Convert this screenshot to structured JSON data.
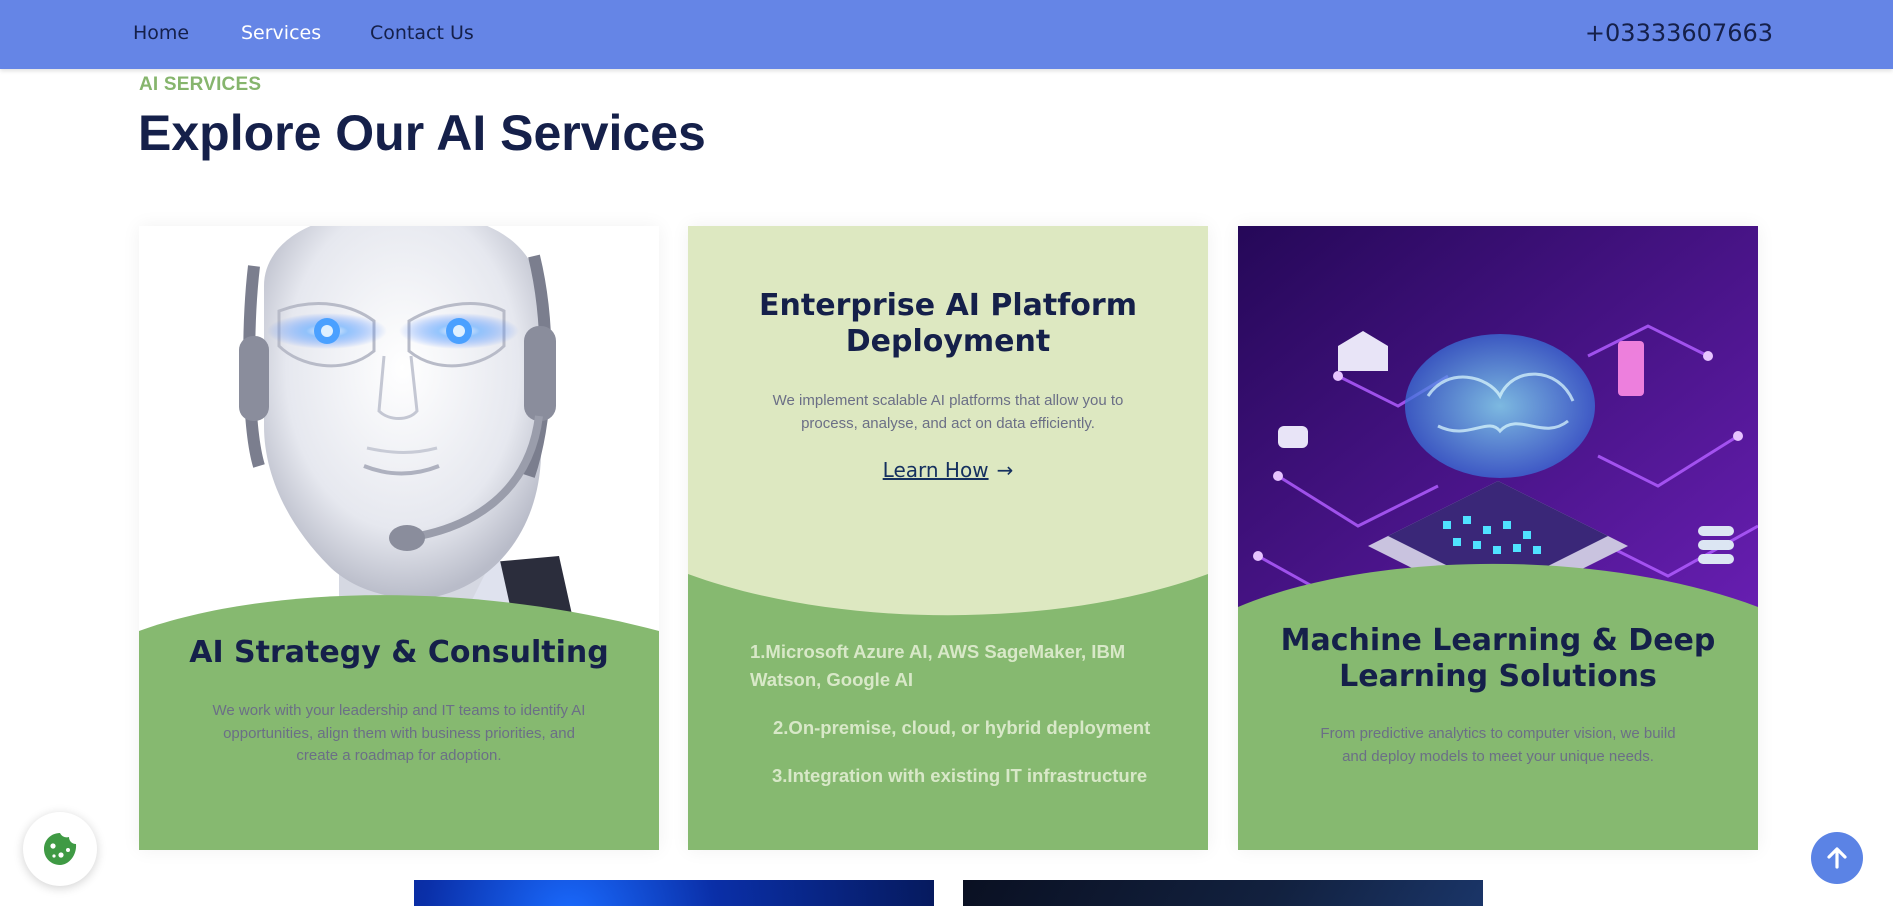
{
  "nav": {
    "items": [
      {
        "label": "Home"
      },
      {
        "label": "Services"
      },
      {
        "label": "Contact Us"
      }
    ],
    "phone": "+03333607663"
  },
  "section": {
    "eyebrow": "AI SERVICES",
    "title": "Explore Our AI Services"
  },
  "cards": [
    {
      "title": "AI Strategy & Consulting",
      "text": "We work with your leadership and IT teams to identify AI opportunities, align them with business priorities, and create a roadmap for adoption."
    },
    {
      "title": "Enterprise AI Platform Deployment",
      "text": "We implement scalable AI platforms that allow you to process, analyse, and act on data efficiently.",
      "link": "Learn How",
      "list": [
        "1.Microsoft Azure AI, AWS SageMaker, IBM Watson, Google AI",
        "2.On-premise, cloud, or hybrid deployment",
        "3.Integration with existing IT infrastructure"
      ]
    },
    {
      "title": "Machine Learning & Deep Learning Solutions",
      "text": "From predictive analytics to computer vision, we build and deploy models to meet your unique needs."
    }
  ],
  "icons": {
    "cookie": "cookie-icon",
    "top": "arrow-up-icon",
    "link": "arrow-right-icon"
  },
  "colors": {
    "nav": "#6585e6",
    "accent_green": "#86b56d",
    "navy": "#15204a"
  }
}
